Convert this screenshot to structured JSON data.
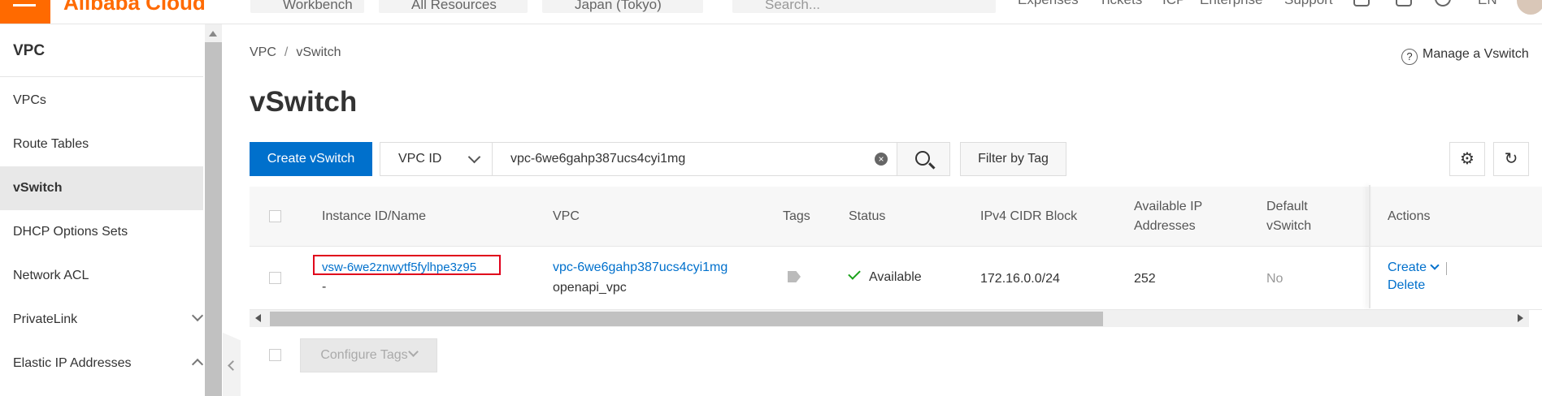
{
  "topbar": {
    "logo": "Alibaba Cloud",
    "workbench": "Workbench",
    "all_resources": "All Resources",
    "region": "Japan (Tokyo)",
    "search_placeholder": "Search...",
    "links": [
      "Expenses",
      "Tickets",
      "ICP",
      "Enterprise",
      "Support"
    ],
    "language": "EN"
  },
  "sidebar": {
    "title": "VPC",
    "items": [
      {
        "label": "VPCs"
      },
      {
        "label": "Route Tables"
      },
      {
        "label": "vSwitch"
      },
      {
        "label": "DHCP Options Sets"
      },
      {
        "label": "Network ACL"
      },
      {
        "label": "PrivateLink"
      },
      {
        "label": "Elastic IP Addresses"
      }
    ]
  },
  "breadcrumb": {
    "root": "VPC",
    "sep": "/",
    "current": "vSwitch"
  },
  "manage_link": "Manage a Vswitch",
  "page_title": "vSwitch",
  "toolbar": {
    "create_label": "Create vSwitch",
    "filter_select": "VPC ID",
    "search_value": "vpc-6we6gahp387ucs4cyi1mg",
    "filter_tag_label": "Filter by Tag"
  },
  "table": {
    "headers": {
      "instance": "Instance ID/Name",
      "vpc": "VPC",
      "tags": "Tags",
      "status": "Status",
      "cidr": "IPv4 CIDR Block",
      "available_1": "Available IP",
      "available_2": "Addresses",
      "default_1": "Default",
      "default_2": "vSwitch",
      "actions": "Actions"
    },
    "rows": [
      {
        "id": "vsw-6we2znwytf5fylhpe3z95",
        "name": "-",
        "vpc_id": "vpc-6we6gahp387ucs4cyi1mg",
        "vpc_name": "openapi_vpc",
        "status": "Available",
        "cidr": "172.16.0.0/24",
        "available_ips": "252",
        "default": "No",
        "action_create": "Create",
        "action_delete": "Delete"
      }
    ]
  },
  "footer": {
    "configure_tags": "Configure Tags"
  },
  "colors": {
    "brand": "#ff6a00",
    "primary": "#0070cc",
    "success": "#1aa11a",
    "highlight": "#e0001b"
  }
}
